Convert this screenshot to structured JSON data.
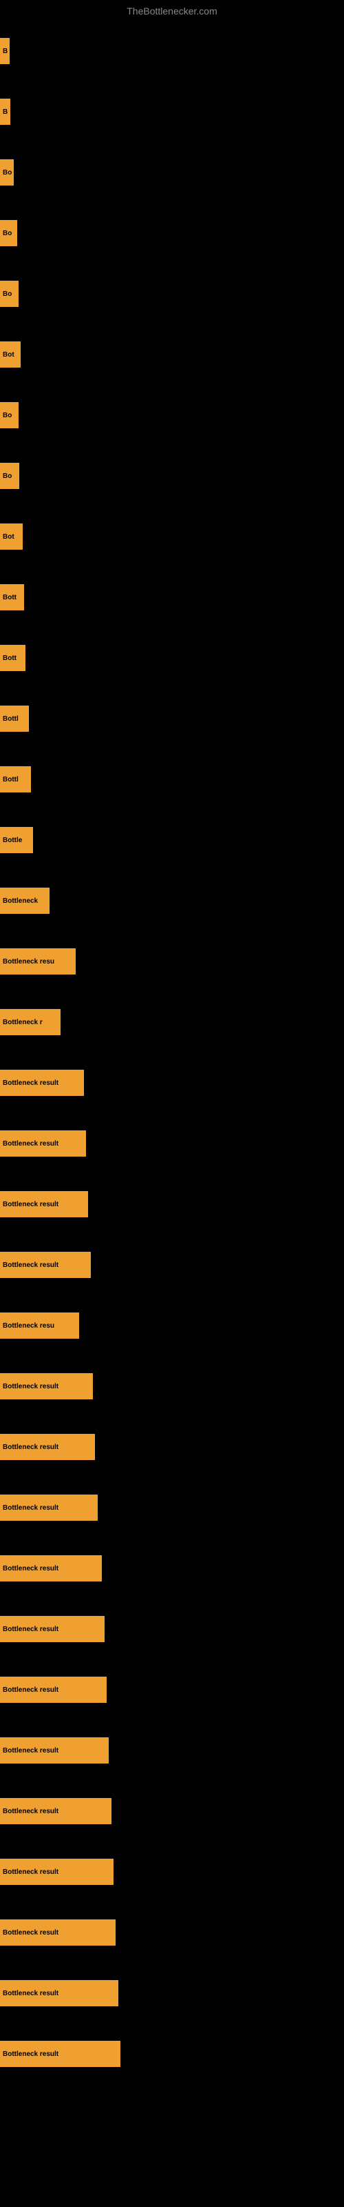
{
  "site": {
    "title": "TheBottlenecker.com"
  },
  "bars": [
    {
      "id": 1,
      "label": "B",
      "width": 14
    },
    {
      "id": 2,
      "label": "B",
      "width": 15
    },
    {
      "id": 3,
      "label": "Bo",
      "width": 20
    },
    {
      "id": 4,
      "label": "Bo",
      "width": 25
    },
    {
      "id": 5,
      "label": "Bo",
      "width": 27
    },
    {
      "id": 6,
      "label": "Bot",
      "width": 30
    },
    {
      "id": 7,
      "label": "Bo",
      "width": 27
    },
    {
      "id": 8,
      "label": "Bo",
      "width": 28
    },
    {
      "id": 9,
      "label": "Bot",
      "width": 33
    },
    {
      "id": 10,
      "label": "Bott",
      "width": 35
    },
    {
      "id": 11,
      "label": "Bott",
      "width": 37
    },
    {
      "id": 12,
      "label": "Bottl",
      "width": 42
    },
    {
      "id": 13,
      "label": "Bottl",
      "width": 45
    },
    {
      "id": 14,
      "label": "Bottle",
      "width": 48
    },
    {
      "id": 15,
      "label": "Bottleneck",
      "width": 72
    },
    {
      "id": 16,
      "label": "Bottleneck resu",
      "width": 110
    },
    {
      "id": 17,
      "label": "Bottleneck r",
      "width": 88
    },
    {
      "id": 18,
      "label": "Bottleneck result",
      "width": 122
    },
    {
      "id": 19,
      "label": "Bottleneck result",
      "width": 125
    },
    {
      "id": 20,
      "label": "Bottleneck result",
      "width": 128
    },
    {
      "id": 21,
      "label": "Bottleneck result",
      "width": 132
    },
    {
      "id": 22,
      "label": "Bottleneck resu",
      "width": 115
    },
    {
      "id": 23,
      "label": "Bottleneck result",
      "width": 135
    },
    {
      "id": 24,
      "label": "Bottleneck result",
      "width": 138
    },
    {
      "id": 25,
      "label": "Bottleneck result",
      "width": 142
    },
    {
      "id": 26,
      "label": "Bottleneck result",
      "width": 148
    },
    {
      "id": 27,
      "label": "Bottleneck result",
      "width": 152
    },
    {
      "id": 28,
      "label": "Bottleneck result",
      "width": 155
    },
    {
      "id": 29,
      "label": "Bottleneck result",
      "width": 158
    },
    {
      "id": 30,
      "label": "Bottleneck result",
      "width": 162
    },
    {
      "id": 31,
      "label": "Bottleneck result",
      "width": 165
    },
    {
      "id": 32,
      "label": "Bottleneck result",
      "width": 168
    },
    {
      "id": 33,
      "label": "Bottleneck result",
      "width": 172
    },
    {
      "id": 34,
      "label": "Bottleneck result",
      "width": 175
    }
  ]
}
